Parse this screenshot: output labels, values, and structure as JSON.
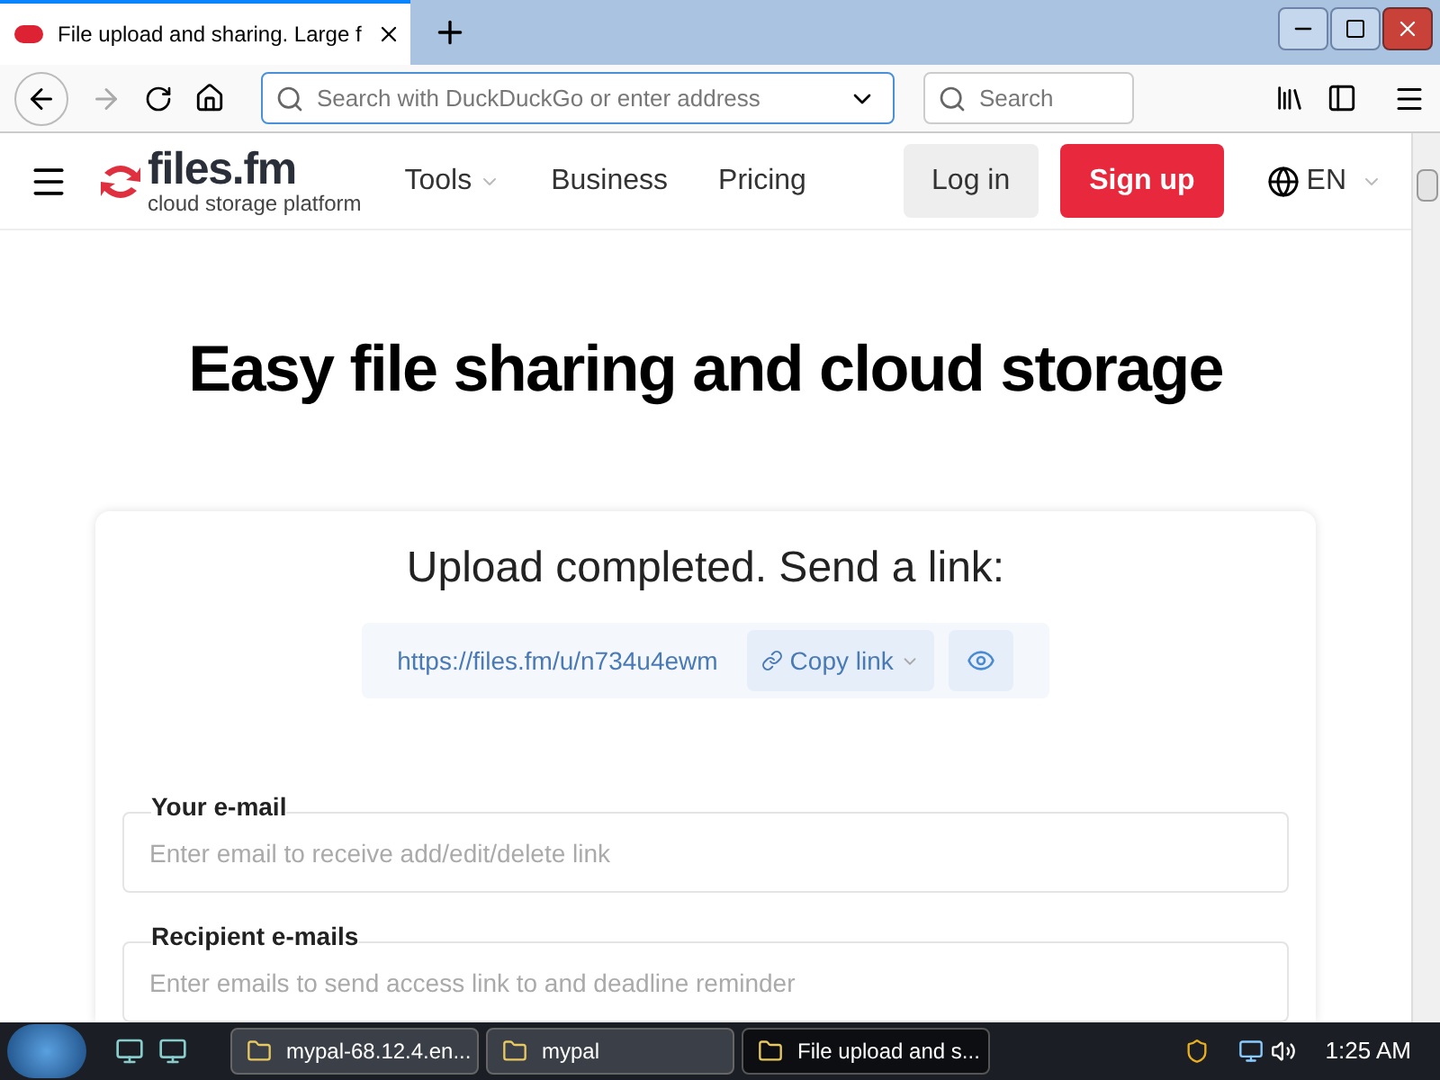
{
  "browser": {
    "tab": {
      "title": "File upload and sharing. Large f"
    },
    "address": {
      "placeholder": "Search with DuckDuckGo or enter address"
    },
    "search": {
      "placeholder": "Search"
    }
  },
  "header": {
    "logo": {
      "name": "files.fm",
      "tagline": "cloud storage platform"
    },
    "nav": [
      {
        "label": "Tools",
        "dropdown": true
      },
      {
        "label": "Business",
        "dropdown": false
      },
      {
        "label": "Pricing",
        "dropdown": false
      }
    ],
    "login": "Log in",
    "signup": "Sign up",
    "language": "EN"
  },
  "heading": "Easy file sharing and cloud storage",
  "card": {
    "title": "Upload completed. Send a link:",
    "link": "https://files.fm/u/n734u4ewm",
    "copy": "Copy link",
    "fields": [
      {
        "label": "Your e-mail",
        "placeholder": "Enter email to receive add/edit/delete link"
      },
      {
        "label": "Recipient e-mails",
        "placeholder": "Enter emails to send access link to and deadline reminder"
      }
    ]
  },
  "taskbar": {
    "items": [
      {
        "label": "mypal-68.12.4.en...",
        "selected": false
      },
      {
        "label": "mypal",
        "selected": false
      },
      {
        "label": "File upload and s...",
        "selected": true
      }
    ],
    "clock": "1:25 AM"
  }
}
